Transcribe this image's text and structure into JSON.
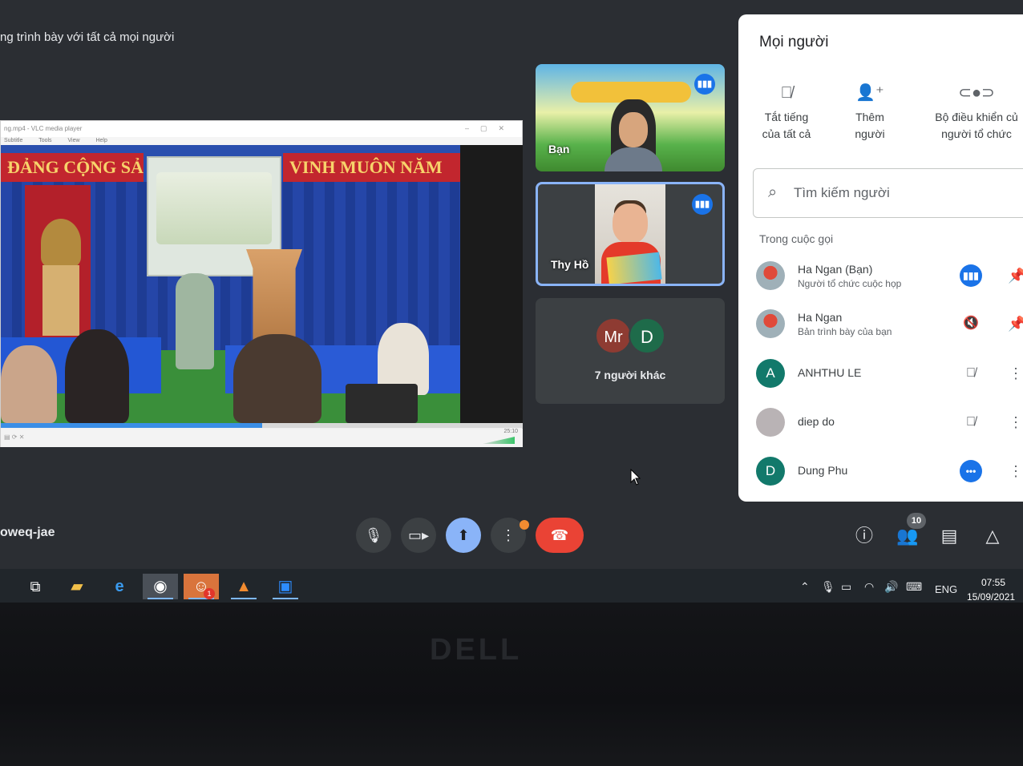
{
  "presentation_banner": "ng trình bày với tất cả mọi người",
  "vlc": {
    "title": "ng.mp4 - VLC media player",
    "menu": [
      "Subtitle",
      "Tools",
      "View",
      "Help"
    ],
    "banner_left": "ĐẢNG CỘNG SẢN V",
    "banner_right": "VINH MUÔN NĂM",
    "time": "25:10",
    "progress": 0.5
  },
  "tiles": {
    "self": {
      "name": "Bạn"
    },
    "thy": {
      "name": "Thy Hồ"
    },
    "others": {
      "avatars": [
        "Mr",
        "D"
      ],
      "label": "7 người khác"
    }
  },
  "people_panel": {
    "title": "Mọi người",
    "actions": [
      {
        "line1": "Tắt tiếng",
        "line2": "của tất cả"
      },
      {
        "line1": "Thêm",
        "line2": "người"
      },
      {
        "line1": "Bộ điều khiển củ",
        "line2": "người tổ chức"
      }
    ],
    "search_placeholder": "Tìm kiếm người",
    "section_label": "Trong cuộc gọi",
    "participants": [
      {
        "name": "Ha Ngan (Bạn)",
        "subtitle": "Người tổ chức cuộc họp",
        "avatar": "",
        "avatar_color": "#9aa7b0"
      },
      {
        "name": "Ha Ngan",
        "subtitle": "Bản trình bày của bạn",
        "avatar": "",
        "avatar_color": "#9aa7b0"
      },
      {
        "name": "ANHTHU LE",
        "subtitle": "",
        "avatar": "A",
        "avatar_color": "#12796b"
      },
      {
        "name": "diep do",
        "subtitle": "",
        "avatar": "",
        "avatar_color": "#b9b3b5"
      },
      {
        "name": "Dung Phu",
        "subtitle": "",
        "avatar": "D",
        "avatar_color": "#12796b"
      }
    ]
  },
  "meeting_code": "oweq-jae",
  "controls": {
    "people_count": "10"
  },
  "taskbar": {
    "badge": "1",
    "language": "ENG",
    "time": "07:55",
    "date": "15/09/2021"
  },
  "bezel_brand": "DELL",
  "colors": {
    "accent_blue": "#1a73e8",
    "hangup_red": "#ea4335",
    "share_blue": "#8ab4f8",
    "panel_bg": "#ffffff",
    "meet_bg": "#2b2e33"
  }
}
